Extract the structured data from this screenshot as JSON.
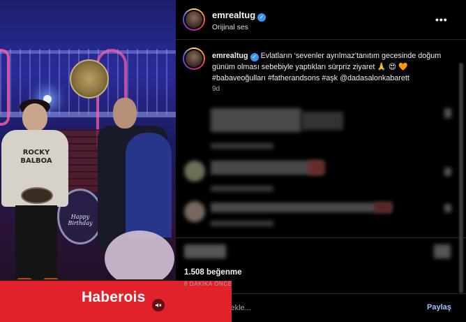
{
  "video": {
    "shirt_text": "ROCKY\nBALBOA",
    "drum_text": "Happy Birthday"
  },
  "watermark": {
    "brand": "Haberois",
    "time_ago": "8 DAKİKA ÖNCE"
  },
  "header": {
    "username": "emrealtug",
    "verified": true,
    "audio": "Orijinal ses",
    "more_label": "•••"
  },
  "caption": {
    "username": "emrealtug",
    "text": "Evlatların ‘sevenler ayrılmaz’tanıtım gecesinde doğum günüm olması sebebiyle yaptıkları sürpriz ziyaret 🙏 😍 🧡 #babaveoğulları #fatherandsons #aşk @dadasalonkabarett",
    "time": "9d"
  },
  "footer": {
    "likes": "1.508 beğenme",
    "comment_placeholder": "Yorum ekle...",
    "share_label": "Paylaş"
  },
  "colors": {
    "accent_blue": "#3897f0",
    "banner_red": "#e2222a",
    "share_link": "#9ec6ff"
  },
  "icons": [
    "verified-badge-icon",
    "more-options-icon",
    "emoji-icon",
    "mute-icon"
  ]
}
